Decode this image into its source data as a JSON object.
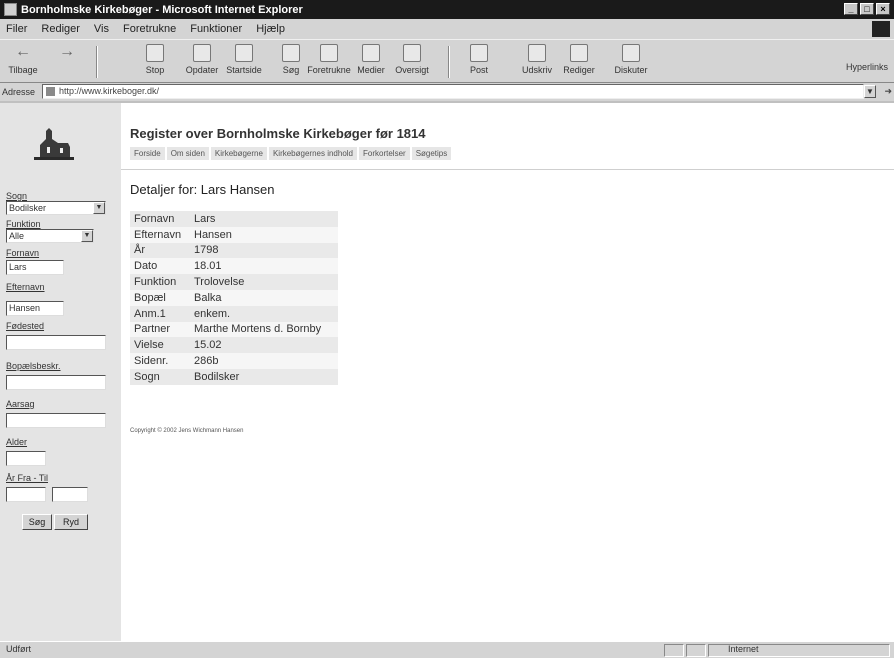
{
  "window": {
    "title": "Bornholmske Kirkebøger - Microsoft Internet Explorer"
  },
  "menu": [
    "Filer",
    "Rediger",
    "Vis",
    "Foretrukne",
    "Funktioner",
    "Hjælp"
  ],
  "toolbar": {
    "buttons": [
      {
        "label": "Tilbage",
        "icon": "back-arrow-icon"
      },
      {
        "label": "",
        "icon": "forward-arrow-icon"
      },
      {
        "label": "Stop",
        "icon": "stop-icon"
      },
      {
        "label": "Opdater",
        "icon": "refresh-icon"
      },
      {
        "label": "Startside",
        "icon": "home-icon"
      },
      {
        "label": "Søg",
        "icon": "search-icon"
      },
      {
        "label": "Foretrukne",
        "icon": "favorites-icon"
      },
      {
        "label": "Medier",
        "icon": "media-icon"
      },
      {
        "label": "Oversigt",
        "icon": "history-icon"
      },
      {
        "label": "Post",
        "icon": "mail-icon"
      },
      {
        "label": "Udskriv",
        "icon": "print-icon"
      },
      {
        "label": "Rediger",
        "icon": "edit-icon"
      },
      {
        "label": "Diskuter",
        "icon": "discuss-icon"
      }
    ],
    "links_label": "Hyperlinks"
  },
  "address": {
    "label": "Adresse",
    "url": "http://www.kirkeboger.dk/"
  },
  "site": {
    "title": "Register over Bornholmske Kirkebøger før 1814",
    "tabs": [
      "Forside",
      "Om siden",
      "Kirkebøgerne",
      "Kirkebøgernes indhold",
      "Forkortelser",
      "Søgetips"
    ]
  },
  "search_form": {
    "sogn_label": "Sogn",
    "sogn_value": "Bodilsker",
    "funktion_label": "Funktion",
    "funktion_value": "Alle",
    "fornavn_label": "Fornavn",
    "fornavn_value": "Lars",
    "efternavn_label": "Efternavn",
    "efternavn_value": "Hansen",
    "fodested_label": "Fødested",
    "bopael_label": "Bopælsbeskr.",
    "aarsag_label": "Aarsag",
    "alder_label": "Alder",
    "aar_label": "År Fra - Til",
    "search_button": "Søg",
    "reset_button": "Ryd"
  },
  "details": {
    "heading": "Detaljer for: Lars Hansen",
    "rows": [
      {
        "key": "Fornavn",
        "value": "Lars"
      },
      {
        "key": "Efternavn",
        "value": "Hansen"
      },
      {
        "key": "År",
        "value": "1798"
      },
      {
        "key": "Dato",
        "value": "18.01"
      },
      {
        "key": "Funktion",
        "value": "Trolovelse"
      },
      {
        "key": "Bopæl",
        "value": "Balka"
      },
      {
        "key": "Anm.1",
        "value": "enkem."
      },
      {
        "key": "Partner",
        "value": "Marthe Mortens d. Bornby"
      },
      {
        "key": "Vielse",
        "value": "15.02"
      },
      {
        "key": "Sidenr.",
        "value": "286b"
      },
      {
        "key": "Sogn",
        "value": "Bodilsker"
      }
    ],
    "copyright": "Copyright © 2002 Jens Wichmann Hansen"
  },
  "status": {
    "left": "Udført",
    "zone": "Internet"
  }
}
